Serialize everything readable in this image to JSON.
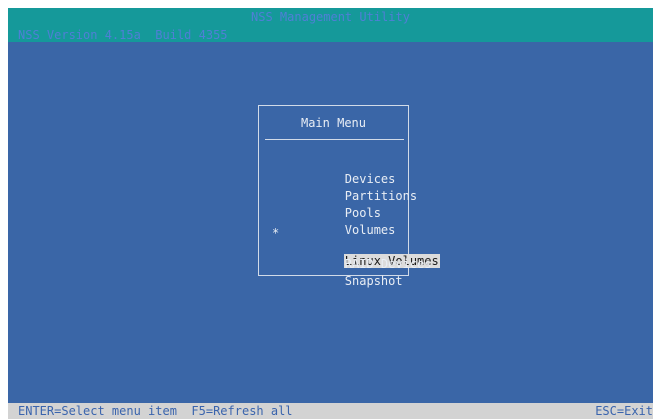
{
  "header": {
    "title": "NSS Management Utility",
    "version": "NSS Version 4.15a  Build 4355"
  },
  "menu": {
    "title": "Main Menu",
    "selected_marker": "*",
    "items": [
      {
        "label": "Devices",
        "selected": false
      },
      {
        "label": "Partitions",
        "selected": false
      },
      {
        "label": "Pools",
        "selected": false
      },
      {
        "label": "Volumes",
        "selected": false
      },
      {
        "label": "Linux Volumes",
        "selected": true
      },
      {
        "label": "RAID Devices",
        "selected": false
      },
      {
        "label": "Snapshot",
        "selected": false
      }
    ]
  },
  "footer": {
    "left": "ENTER=Select menu item  F5=Refresh all",
    "right": "ESC=Exit"
  },
  "colors": {
    "screen_background": "#3a66a7",
    "header_background": "#15999a",
    "footer_background": "#d3d3d3",
    "selection_highlight": "#dcdcdc"
  }
}
